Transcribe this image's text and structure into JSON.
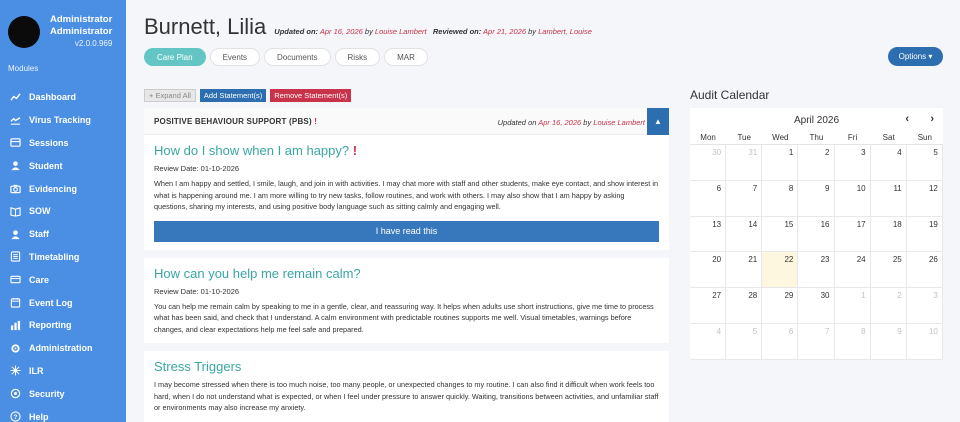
{
  "profile": {
    "name_line1": "Administrator",
    "name_line2": "Administrator",
    "version": "v2.0.0.969"
  },
  "sidebar": {
    "modules_label": "Modules",
    "items": [
      {
        "label": "Dashboard",
        "icon": "dashboard-icon"
      },
      {
        "label": "Virus Tracking",
        "icon": "virus-icon"
      },
      {
        "label": "Sessions",
        "icon": "sessions-icon"
      },
      {
        "label": "Student",
        "icon": "student-icon"
      },
      {
        "label": "Evidencing",
        "icon": "camera-icon"
      },
      {
        "label": "SOW",
        "icon": "book-icon"
      },
      {
        "label": "Staff",
        "icon": "staff-icon"
      },
      {
        "label": "Timetabling",
        "icon": "timetable-icon"
      },
      {
        "label": "Care",
        "icon": "care-icon"
      },
      {
        "label": "Event Log",
        "icon": "event-log-icon"
      },
      {
        "label": "Reporting",
        "icon": "reporting-icon"
      },
      {
        "label": "Administration",
        "icon": "administration-icon"
      },
      {
        "label": "ILR",
        "icon": "ilr-icon"
      },
      {
        "label": "Security",
        "icon": "security-icon"
      },
      {
        "label": "Help",
        "icon": "help-icon"
      }
    ]
  },
  "header": {
    "name": "Burnett, Lilia",
    "updated_label": "Updated on:",
    "updated_date": "Apr 16, 2026",
    "updated_by_label": "by",
    "updated_by": "Louise Lambert",
    "reviewed_label": "Reviewed on:",
    "reviewed_date": "Apr 21, 2026",
    "reviewed_by_label": "by",
    "reviewed_by": "Lambert, Louise"
  },
  "tabs": [
    "Care Plan",
    "Events",
    "Documents",
    "Risks",
    "MAR"
  ],
  "options_label": "Options ▾",
  "toolbar": {
    "expand_label": "+ Expand All",
    "add_label": "Add Statement(s)",
    "remove_label": "Remove Statement(s)"
  },
  "panel": {
    "title": "POSITIVE BEHAVIOUR SUPPORT (PBS)",
    "title_flag": "!",
    "updated_prefix": "Updated on",
    "updated_date": "Apr 16, 2026",
    "updated_by_label": "by",
    "updated_by": "Louise Lambert",
    "toggle_glyph": "▲",
    "sections": [
      {
        "title": "How do I show when I am happy?",
        "flag": "!",
        "review": "Review Date: 01-10-2026",
        "text": "When I am happy and settled, I smile, laugh, and join in with activities. I may chat more with staff and other students, make eye contact, and show interest in what is happening around me. I am more willing to try new tasks, follow routines, and work with others. I may also show that I am happy by asking questions, sharing my interests, and using positive body language such as sitting calmly and engaging well.",
        "button": "I have read this"
      },
      {
        "title": "How can you help me remain calm?",
        "review": "Review Date: 01-10-2026",
        "text": "You can help me remain calm by speaking to me in a gentle, clear, and reassuring way. It helps when adults use short instructions, give me time to process what has been said, and check that I understand. A calm environment with predictable routines supports me well. Visual timetables, warnings before changes, and clear expectations help me feel safe and prepared."
      },
      {
        "title": "Stress Triggers",
        "text": "I may become stressed when there is too much noise, too many people, or unexpected changes to my routine. I can also find it difficult when work feels too hard, when I do not understand what is expected, or when I feel under pressure to answer quickly. Waiting, transitions between activities, and unfamiliar staff or environments may also increase my anxiety."
      }
    ]
  },
  "calendar": {
    "heading": "Audit Calendar",
    "month": "April 2026",
    "prev": "‹",
    "next": "›",
    "days_of_week": [
      "Mon",
      "Tue",
      "Wed",
      "Thu",
      "Fri",
      "Sat",
      "Sun"
    ],
    "weeks": [
      [
        {
          "d": "30",
          "o": true
        },
        {
          "d": "31",
          "o": true
        },
        {
          "d": "1"
        },
        {
          "d": "2"
        },
        {
          "d": "3"
        },
        {
          "d": "4"
        },
        {
          "d": "5"
        }
      ],
      [
        {
          "d": "6"
        },
        {
          "d": "7"
        },
        {
          "d": "8"
        },
        {
          "d": "9"
        },
        {
          "d": "10"
        },
        {
          "d": "11"
        },
        {
          "d": "12"
        }
      ],
      [
        {
          "d": "13"
        },
        {
          "d": "14"
        },
        {
          "d": "15"
        },
        {
          "d": "16"
        },
        {
          "d": "17"
        },
        {
          "d": "18"
        },
        {
          "d": "19"
        }
      ],
      [
        {
          "d": "20"
        },
        {
          "d": "21"
        },
        {
          "d": "22",
          "today": true
        },
        {
          "d": "23"
        },
        {
          "d": "24"
        },
        {
          "d": "25"
        },
        {
          "d": "26"
        }
      ],
      [
        {
          "d": "27"
        },
        {
          "d": "28"
        },
        {
          "d": "29"
        },
        {
          "d": "30"
        },
        {
          "d": "1",
          "o": true
        },
        {
          "d": "2",
          "o": true
        },
        {
          "d": "3",
          "o": true
        }
      ],
      [
        {
          "d": "4",
          "o": true
        },
        {
          "d": "5",
          "o": true
        },
        {
          "d": "6",
          "o": true
        },
        {
          "d": "7",
          "o": true
        },
        {
          "d": "8",
          "o": true
        },
        {
          "d": "9",
          "o": true
        },
        {
          "d": "10",
          "o": true
        }
      ]
    ]
  },
  "colors": {
    "sidebar": "#4a8fe4",
    "accent_teal": "#63c6c5",
    "primary_blue": "#2c6eaf",
    "danger_red": "#c8324a"
  }
}
